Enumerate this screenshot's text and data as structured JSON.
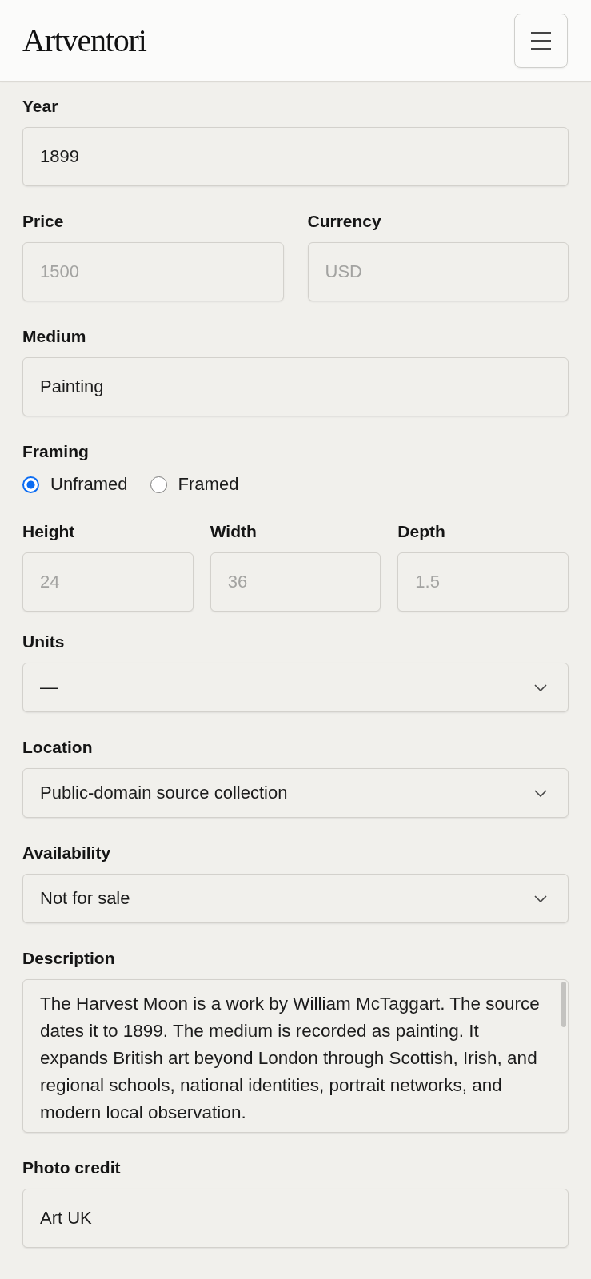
{
  "header": {
    "logo": "Artventori"
  },
  "form": {
    "rows": [
      {
        "fields": [
          {
            "kind": "text",
            "label": "Year",
            "value": "1899"
          }
        ]
      },
      {
        "fields": [
          {
            "kind": "text",
            "label": "Price",
            "placeholder": "1500"
          },
          {
            "kind": "text",
            "label": "Currency",
            "placeholder": "USD"
          }
        ]
      },
      {
        "fields": [
          {
            "kind": "text",
            "label": "Medium",
            "value": "Painting"
          }
        ]
      },
      {
        "fields": [
          {
            "kind": "radio",
            "label": "Framing",
            "options": [
              {
                "label": "Unframed",
                "selected": true
              },
              {
                "label": "Framed",
                "selected": false
              }
            ]
          }
        ]
      },
      {
        "fields": [
          {
            "kind": "text",
            "label": "Height",
            "placeholder": "24"
          },
          {
            "kind": "text",
            "label": "Width",
            "placeholder": "36"
          },
          {
            "kind": "text",
            "label": "Depth",
            "placeholder": "1.5"
          }
        ]
      },
      {
        "fields": [
          {
            "kind": "select",
            "label": "Units",
            "value": "—"
          }
        ]
      },
      {
        "fields": [
          {
            "kind": "select",
            "label": "Location",
            "value": "Public-domain source collection"
          }
        ]
      },
      {
        "fields": [
          {
            "kind": "select",
            "label": "Availability",
            "value": "Not for sale"
          }
        ]
      },
      {
        "fields": [
          {
            "kind": "textarea",
            "label": "Description",
            "value": "The Harvest Moon is a work by William McTaggart. The source dates it to 1899. The medium is recorded as painting. It expands British art beyond London through Scottish, Irish, and regional schools, national identities, portrait networks, and modern local observation."
          }
        ]
      },
      {
        "fields": [
          {
            "kind": "text",
            "label": "Photo credit",
            "value": "Art UK"
          }
        ]
      }
    ]
  }
}
